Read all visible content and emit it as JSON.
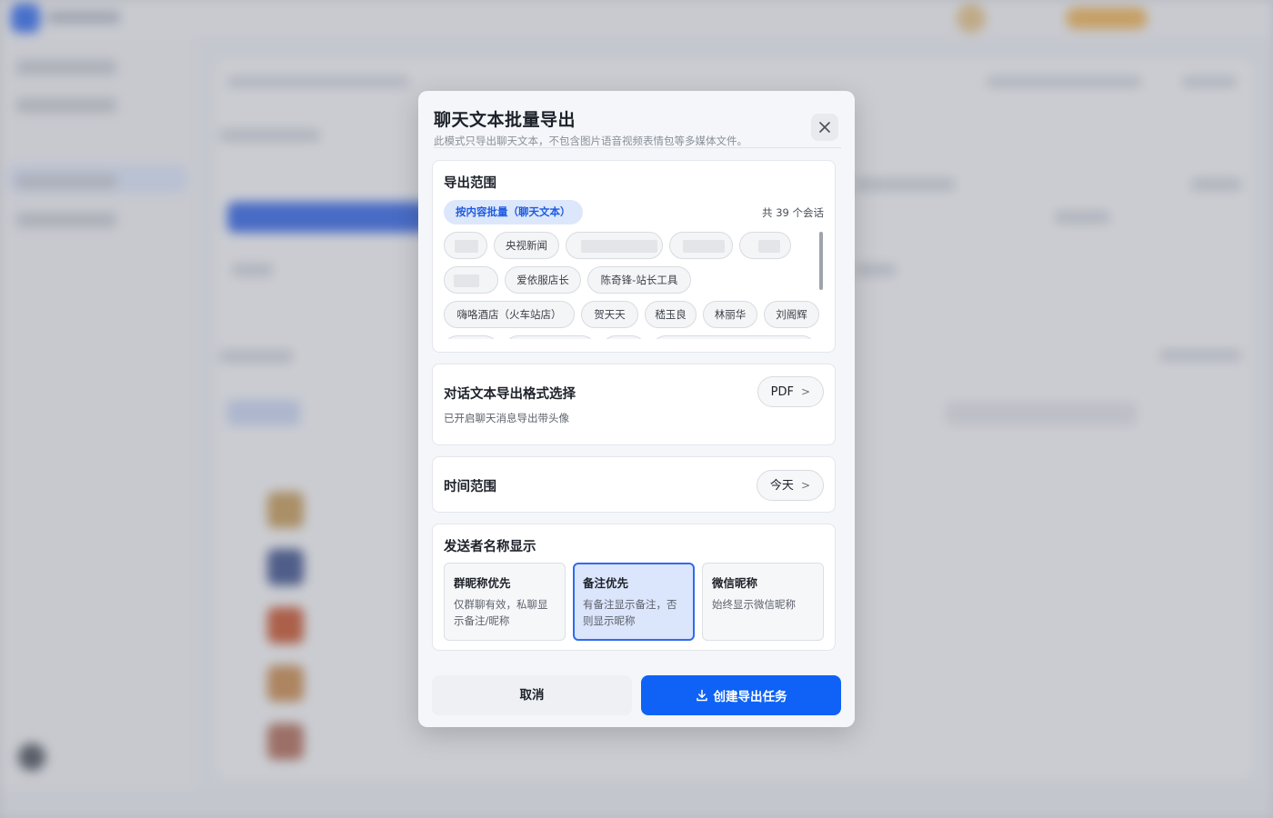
{
  "dialog": {
    "title": "聊天文本批量导出",
    "subtitle": "此模式只导出聊天文本，不包含图片语音视频表情包等多媒体文件。",
    "close_icon": "close-icon"
  },
  "scope": {
    "title": "导出范围",
    "mode_label": "按内容批量（聊天文本）",
    "count_label": "共 39 个会话",
    "chips": [
      {
        "label": "",
        "redacted": true
      },
      {
        "label": "央视新闻",
        "redacted": false
      },
      {
        "label": "",
        "redacted": true
      },
      {
        "label": "",
        "redacted": true
      },
      {
        "label": "",
        "redacted": true
      },
      {
        "label": "",
        "redacted": true
      },
      {
        "label": "爱依服店长",
        "redacted": false
      },
      {
        "label": "陈奇锋-站长工具",
        "redacted": false
      },
      {
        "label": "嗨咯酒店（火车站店）",
        "redacted": false
      },
      {
        "label": "贺天天",
        "redacted": false
      },
      {
        "label": "嵇玉良",
        "redacted": false
      },
      {
        "label": "林丽华",
        "redacted": false
      },
      {
        "label": "刘阁辉",
        "redacted": false
      }
    ]
  },
  "format": {
    "title": "对话文本导出格式选择",
    "description": "已开启聊天消息导出带头像",
    "value": "PDF",
    "chevron": ">"
  },
  "time_range": {
    "title": "时间范围",
    "value": "今天",
    "chevron": ">"
  },
  "sender_name": {
    "title": "发送者名称显示",
    "options": [
      {
        "title": "群昵称优先",
        "desc": "仅群聊有效，私聊显示备注/昵称",
        "selected": false
      },
      {
        "title": "备注优先",
        "desc": "有备注显示备注，否则显示昵称",
        "selected": true
      },
      {
        "title": "微信昵称",
        "desc": "始终显示微信昵称",
        "selected": false
      }
    ]
  },
  "footer": {
    "cancel_label": "取消",
    "create_label": "创建导出任务",
    "create_icon": "download-icon"
  },
  "colors": {
    "accent": "#0f62f5",
    "selected_bg": "#dbe5fb",
    "pill_text": "#1f5ce0"
  }
}
